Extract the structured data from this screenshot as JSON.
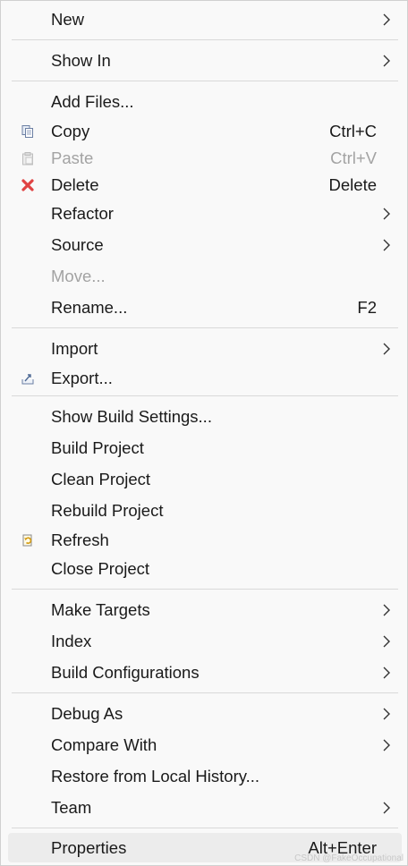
{
  "menu": {
    "new": {
      "label": "New"
    },
    "show_in": {
      "label": "Show In"
    },
    "add_files": {
      "label": "Add Files..."
    },
    "copy": {
      "label": "Copy",
      "shortcut": "Ctrl+C",
      "icon": "copy-icon"
    },
    "paste": {
      "label": "Paste",
      "shortcut": "Ctrl+V",
      "icon": "paste-icon",
      "disabled": true
    },
    "delete": {
      "label": "Delete",
      "shortcut": "Delete",
      "icon": "delete-icon",
      "icon_color": "#e04343"
    },
    "refactor": {
      "label": "Refactor"
    },
    "source": {
      "label": "Source"
    },
    "move": {
      "label": "Move...",
      "disabled": true
    },
    "rename": {
      "label": "Rename...",
      "shortcut": "F2"
    },
    "import": {
      "label": "Import"
    },
    "export": {
      "label": "Export...",
      "icon": "export-icon"
    },
    "show_build_settings": {
      "label": "Show Build Settings..."
    },
    "build_project": {
      "label": "Build Project"
    },
    "clean_project": {
      "label": "Clean Project"
    },
    "rebuild_project": {
      "label": "Rebuild Project"
    },
    "refresh": {
      "label": "Refresh",
      "icon": "refresh-icon"
    },
    "close_project": {
      "label": "Close Project"
    },
    "make_targets": {
      "label": "Make Targets"
    },
    "index": {
      "label": "Index"
    },
    "build_configurations": {
      "label": "Build Configurations"
    },
    "debug_as": {
      "label": "Debug As"
    },
    "compare_with": {
      "label": "Compare With"
    },
    "restore_local_history": {
      "label": "Restore from Local History..."
    },
    "team": {
      "label": "Team"
    },
    "properties": {
      "label": "Properties",
      "shortcut": "Alt+Enter",
      "highlighted": true
    }
  },
  "watermark": "CSDN @FakeOccupational"
}
